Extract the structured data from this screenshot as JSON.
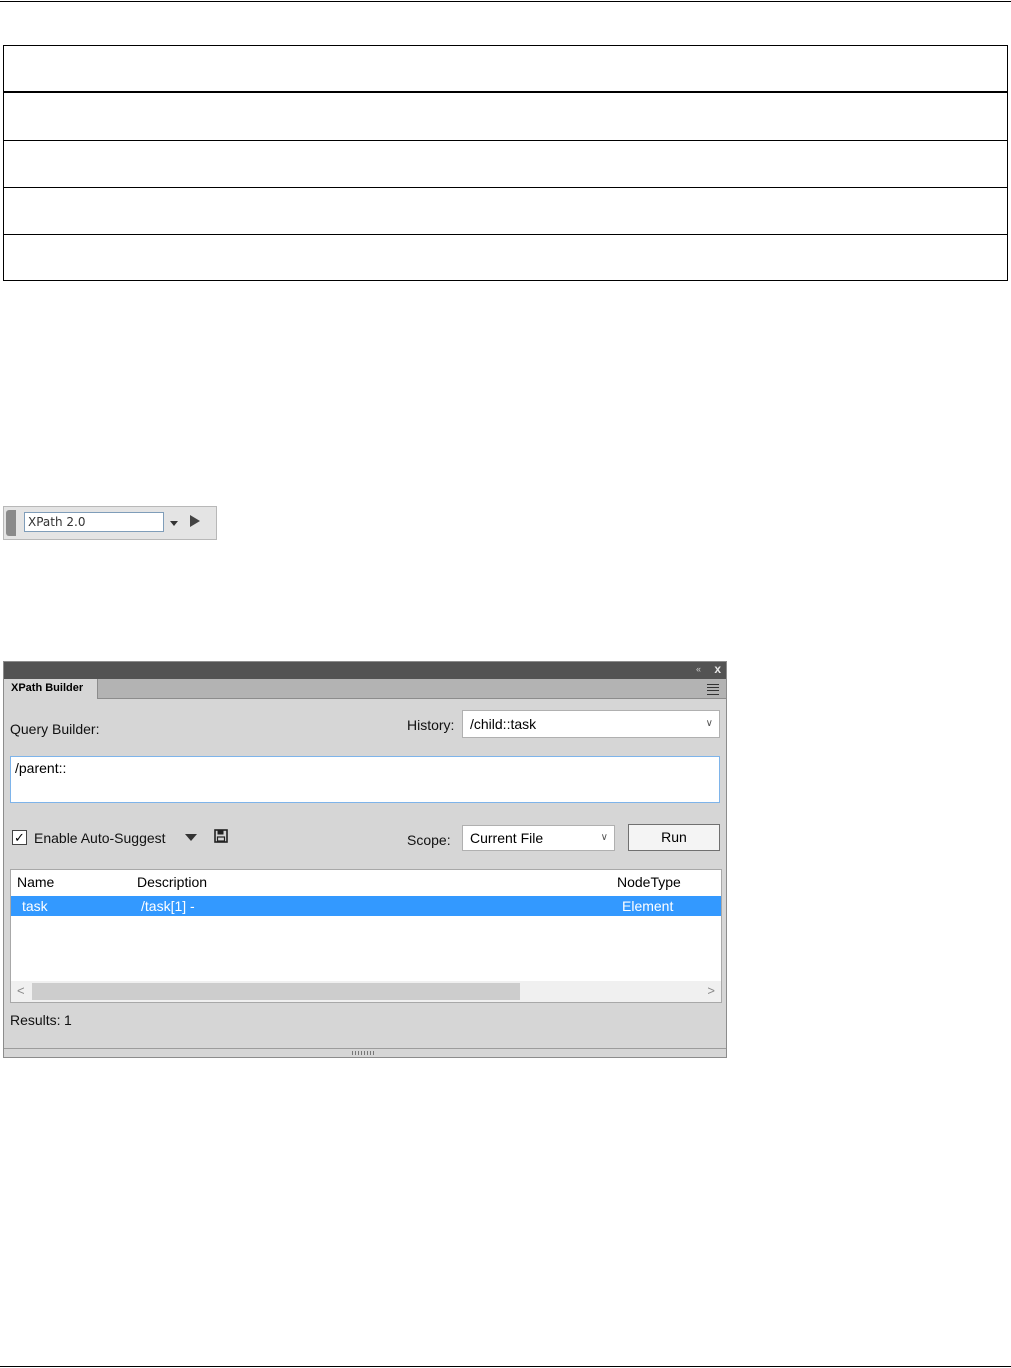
{
  "toolbar": {
    "xpath_version": "XPath 2.0"
  },
  "panel": {
    "tab_label": "XPath Builder",
    "collapse_glyph": "‹‹",
    "close_glyph": "x",
    "query_builder_label": "Query Builder:",
    "history_label": "History:",
    "history_value": "/child::task",
    "query_text": "/parent::",
    "auto_suggest_label": "Enable Auto-Suggest",
    "auto_suggest_checked": true,
    "scope_label": "Scope:",
    "scope_value": "Current File",
    "run_label": "Run",
    "columns": {
      "name": "Name",
      "description": "Description",
      "node_type": "NodeType"
    },
    "rows": [
      {
        "name": "task",
        "description": "/task[1] -",
        "node_type": "Element"
      }
    ],
    "results_label": "Results:",
    "results_count": "1",
    "selection_color": "#3399ff"
  }
}
